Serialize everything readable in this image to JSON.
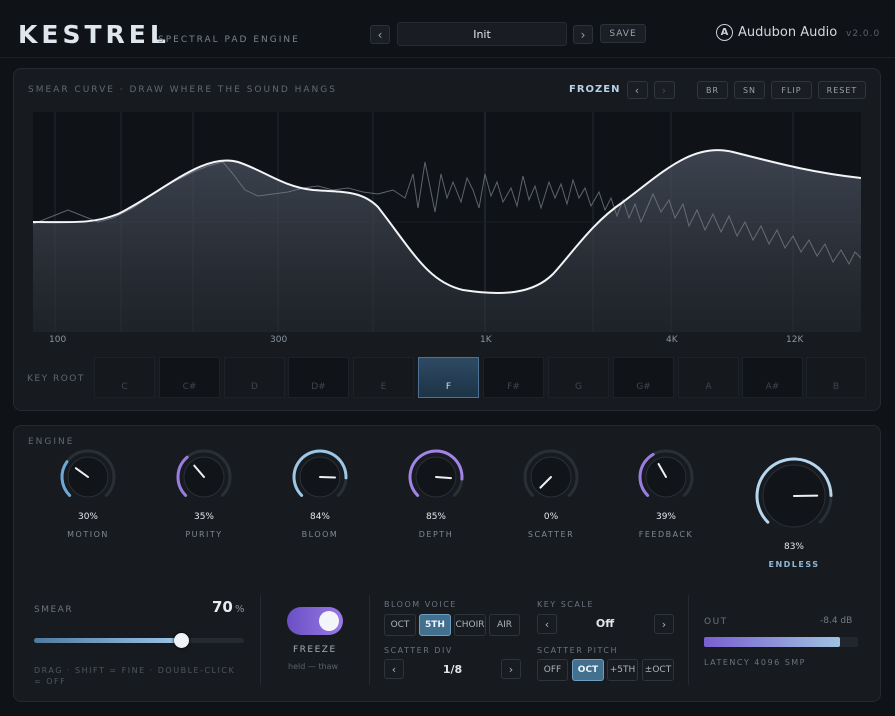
{
  "header": {
    "brand": "KESTREL",
    "subtitle": "SPECTRAL PAD ENGINE",
    "preset_name": "Init",
    "prev_label": "‹",
    "next_label": "›",
    "save_label": "SAVE",
    "company": "Audubon Audio",
    "logo_letter": "A",
    "version": "v2.0.0"
  },
  "curve_panel": {
    "title": "SMEAR CURVE · DRAW WHERE THE SOUND HANGS",
    "status": "FROZEN",
    "nav_prev": "‹",
    "nav_next": "›",
    "buttons": [
      "BR",
      "SN",
      "FLIP",
      "RESET"
    ],
    "freq_labels": [
      "100",
      "300",
      "1K",
      "4K",
      "12K"
    ]
  },
  "key_root": {
    "label": "KEY ROOT",
    "keys": [
      "C",
      "C#",
      "D",
      "D#",
      "E",
      "F",
      "F#",
      "G",
      "G#",
      "A",
      "A#",
      "B"
    ],
    "selected": "F"
  },
  "engine": {
    "title": "ENGINE",
    "knobs": [
      {
        "label": "MOTION",
        "value": "30%",
        "level": 0.3,
        "color": "#6fa8d4"
      },
      {
        "label": "PURITY",
        "value": "35%",
        "level": 0.35,
        "color": "#9a7de0"
      },
      {
        "label": "BLOOM",
        "value": "84%",
        "level": 0.84,
        "color": "#9cc7e6"
      },
      {
        "label": "DEPTH",
        "value": "85%",
        "level": 0.85,
        "color": "#a284e6"
      },
      {
        "label": "SCATTER",
        "value": "0%",
        "level": 0.0,
        "color": "#6fa8d4"
      },
      {
        "label": "FEEDBACK",
        "value": "39%",
        "level": 0.39,
        "color": "#9a7de0"
      }
    ],
    "main_knob": {
      "label": "ENDLESS",
      "value": "83%",
      "level": 0.83,
      "color": "#b7d6ee"
    }
  },
  "smear": {
    "label": "SMEAR",
    "value": "70",
    "unit": "%",
    "level": 0.7,
    "hint": "DRAG · SHIFT = FINE · DOUBLE-CLICK = OFF"
  },
  "freeze": {
    "label": "FREEZE",
    "hint": "held — thaw",
    "on": true
  },
  "bloom_voice": {
    "label": "BLOOM VOICE",
    "options": [
      "OCT",
      "5TH",
      "CHOIR",
      "AIR"
    ],
    "selected": "5TH"
  },
  "scatter_div": {
    "label": "SCATTER DIV",
    "value": "1/8",
    "prev": "‹",
    "next": "›"
  },
  "key_scale": {
    "label": "KEY SCALE",
    "value": "Off",
    "prev": "‹",
    "next": "›"
  },
  "scatter_pitch": {
    "label": "SCATTER PITCH",
    "options": [
      "OFF",
      "OCT",
      "+5TH",
      "±OCT"
    ],
    "selected": "OCT"
  },
  "output": {
    "label": "OUT",
    "db": "-8.4 dB",
    "level": 0.88,
    "latency": "LATENCY 4096 SMP"
  },
  "colors": {
    "accent_blue": "#6fa8d4",
    "accent_purple": "#8f6fe0",
    "panel": "#171b20"
  }
}
